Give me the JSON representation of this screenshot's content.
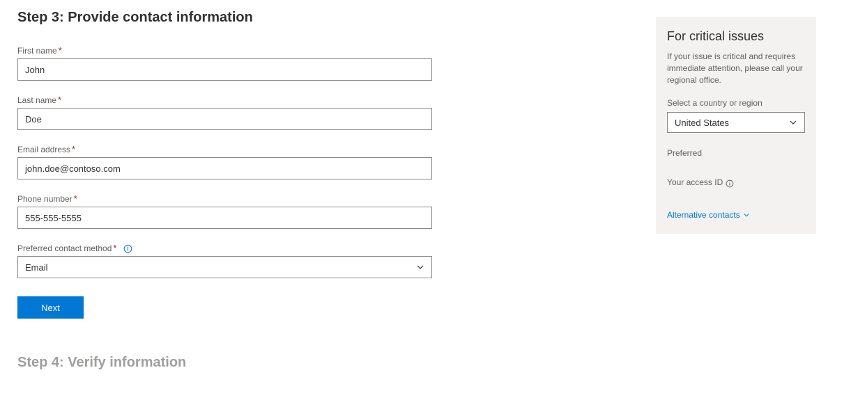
{
  "main": {
    "step3_heading": "Step 3: Provide contact information",
    "step4_heading": "Step 4: Verify information",
    "required_mark": "*",
    "fields": {
      "first_name": {
        "label": "First name",
        "value": "John"
      },
      "last_name": {
        "label": "Last name",
        "value": "Doe"
      },
      "email": {
        "label": "Email address",
        "value": "john.doe@contoso.com"
      },
      "phone": {
        "label": "Phone number",
        "value": "555-555-5555"
      },
      "contact_method": {
        "label": "Preferred contact method",
        "value": "Email"
      }
    },
    "next_button": "Next"
  },
  "sidebar": {
    "heading": "For critical issues",
    "description": "If your issue is critical and requires immediate attention, please call your regional office.",
    "region_label": "Select a country or region",
    "region_value": "United States",
    "preferred_label": "Preferred",
    "access_id_label": "Your access ID",
    "alt_contacts_label": "Alternative contacts"
  }
}
